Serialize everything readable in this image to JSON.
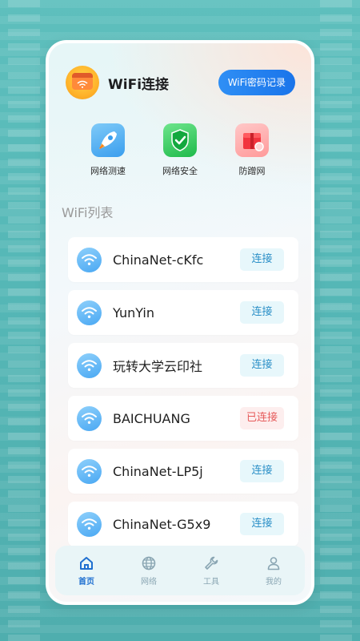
{
  "header": {
    "title": "WiFi连接",
    "password_button": "WiFi密码记录"
  },
  "tools": [
    {
      "label": "网络测速",
      "icon": "rocket-icon"
    },
    {
      "label": "网络安全",
      "icon": "shield-check-icon"
    },
    {
      "label": "防蹭网",
      "icon": "gift-box-icon"
    }
  ],
  "section": {
    "title": "WiFi列表"
  },
  "wifi_list": [
    {
      "name": "ChinaNet-cKfc",
      "action": "连接",
      "connected": false
    },
    {
      "name": "YunYin",
      "action": "连接",
      "connected": false
    },
    {
      "name": "玩转大学云印社",
      "action": "连接",
      "connected": false
    },
    {
      "name": "BAICHUANG",
      "action": "已连接",
      "connected": true
    },
    {
      "name": "ChinaNet-LP5j",
      "action": "连接",
      "connected": false
    },
    {
      "name": "ChinaNet-G5x9",
      "action": "连接",
      "connected": false
    }
  ],
  "tabbar": [
    {
      "label": "首页",
      "icon": "home-icon",
      "active": true
    },
    {
      "label": "网络",
      "icon": "globe-icon",
      "active": false
    },
    {
      "label": "工具",
      "icon": "wrench-icon",
      "active": false
    },
    {
      "label": "我的",
      "icon": "user-icon",
      "active": false
    }
  ],
  "colors": {
    "accent": "#1a74ea",
    "connect_text": "#2a8fc7",
    "connected_text": "#e65a5a",
    "background": "#55b7b6"
  }
}
